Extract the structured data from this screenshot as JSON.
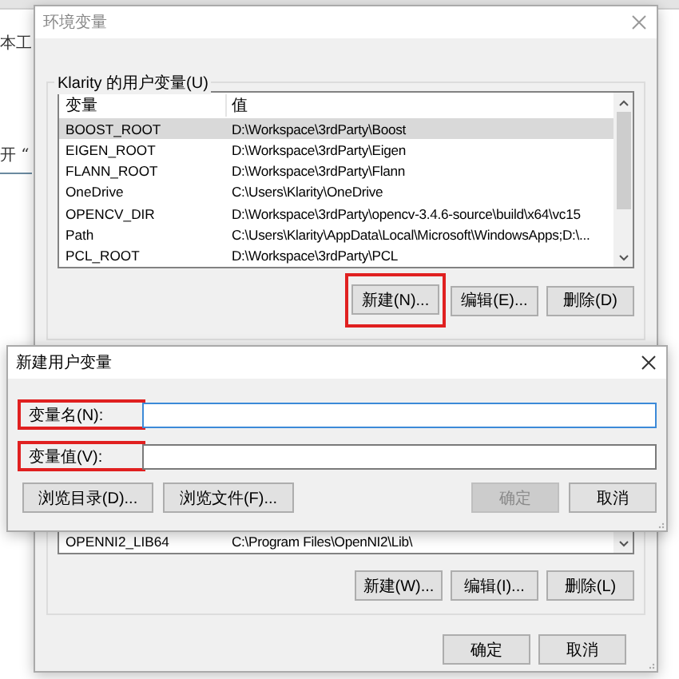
{
  "background": {
    "texts": [
      "本工",
      "开 “"
    ]
  },
  "env_dialog": {
    "title": "环境变量",
    "user_group": {
      "label": "Klarity 的用户变量(U)",
      "columns": [
        "变量",
        "值"
      ],
      "rows": [
        {
          "name": "BOOST_ROOT",
          "value": "D:\\Workspace\\3rdParty\\Boost",
          "selected": true
        },
        {
          "name": "EIGEN_ROOT",
          "value": "D:\\Workspace\\3rdParty\\Eigen",
          "selected": false
        },
        {
          "name": "FLANN_ROOT",
          "value": "D:\\Workspace\\3rdParty\\Flann",
          "selected": false
        },
        {
          "name": "OneDrive",
          "value": "C:\\Users\\Klarity\\OneDrive",
          "selected": false
        },
        {
          "name": "OPENCV_DIR",
          "value": "D:\\Workspace\\3rdParty\\opencv-3.4.6-source\\build\\x64\\vc15",
          "selected": false
        },
        {
          "name": "Path",
          "value": "C:\\Users\\Klarity\\AppData\\Local\\Microsoft\\WindowsApps;D:\\...",
          "selected": false
        },
        {
          "name": "PCL_ROOT",
          "value": "D:\\Workspace\\3rdParty\\PCL",
          "selected": false
        }
      ],
      "buttons": [
        {
          "label": "新建(N)...",
          "highlighted": true
        },
        {
          "label": "编辑(E)...",
          "highlighted": false
        },
        {
          "label": "删除(D)",
          "highlighted": false
        }
      ]
    },
    "system_group": {
      "rows": [
        {
          "name": "OPENNI2_LIB64",
          "value": "C:\\Program Files\\OpenNI2\\Lib\\"
        }
      ],
      "buttons": [
        "新建(W)...",
        "编辑(I)...",
        "删除(L)"
      ]
    },
    "buttons": [
      "确定",
      "取消"
    ]
  },
  "new_variable_dialog": {
    "title": "新建用户变量",
    "fields": [
      {
        "label": "变量名(N):",
        "highlighted": true
      },
      {
        "label": "变量值(V):",
        "highlighted": true
      }
    ],
    "left_buttons": [
      {
        "label": "浏览目录(D)...",
        "disabled": false
      },
      {
        "label": "浏览文件(F)...",
        "disabled": false
      }
    ],
    "right_buttons": [
      {
        "label": "确定",
        "disabled": true
      },
      {
        "label": "取消",
        "disabled": false
      }
    ]
  }
}
